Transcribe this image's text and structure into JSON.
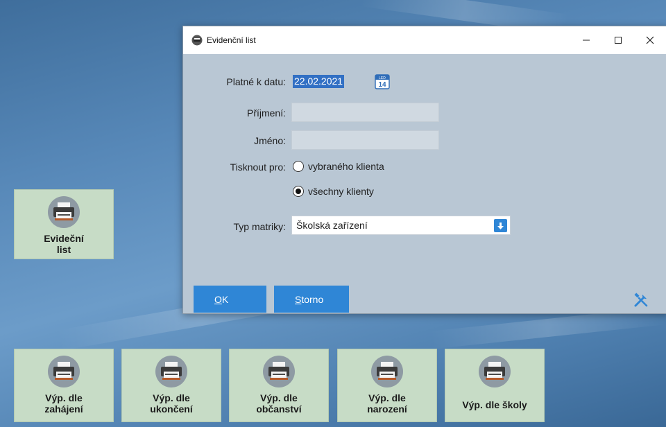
{
  "desktop": {
    "top_tiles": [
      {
        "label": "Evideční\nlist",
        "icon": "printer-icon"
      }
    ],
    "bottom_tiles": [
      {
        "label": "Výp. dle\nzahájení",
        "icon": "printer-icon"
      },
      {
        "label": "Výp. dle\nukončení",
        "icon": "printer-icon"
      },
      {
        "label": "Výp. dle\nobčanství",
        "icon": "printer-icon"
      },
      {
        "label": "Výp. dle\nnarození",
        "icon": "printer-icon"
      },
      {
        "label": "Výp. dle školy",
        "icon": "printer-icon"
      }
    ]
  },
  "dialog": {
    "title": "Evidenční list",
    "controls": {
      "minimize": "—",
      "maximize": "☐",
      "close": "✕"
    },
    "fields": {
      "date_label": "Platné k datu:",
      "date_value": "22.02.2021",
      "calendar_month": "LED",
      "calendar_day": "14",
      "surname_label": "Příjmení:",
      "surname_value": "",
      "name_label": "Jméno:",
      "name_value": "",
      "print_for_label": "Tisknout pro:",
      "radio_selected_client": "vybraného klienta",
      "radio_all_clients": "všechny klienty",
      "selected_option": "all_clients",
      "matrix_type_label": "Typ matriky:",
      "matrix_type_value": "Školská zařízení"
    },
    "buttons": {
      "ok_mnemonic": "O",
      "ok_rest": "K",
      "cancel_mnemonic": "S",
      "cancel_rest": "torno"
    }
  },
  "colors": {
    "accent": "#2f86d6",
    "tile_bg": "#c7dcc6",
    "dialog_bg": "#b9c7d4",
    "selection": "#3270c4"
  }
}
